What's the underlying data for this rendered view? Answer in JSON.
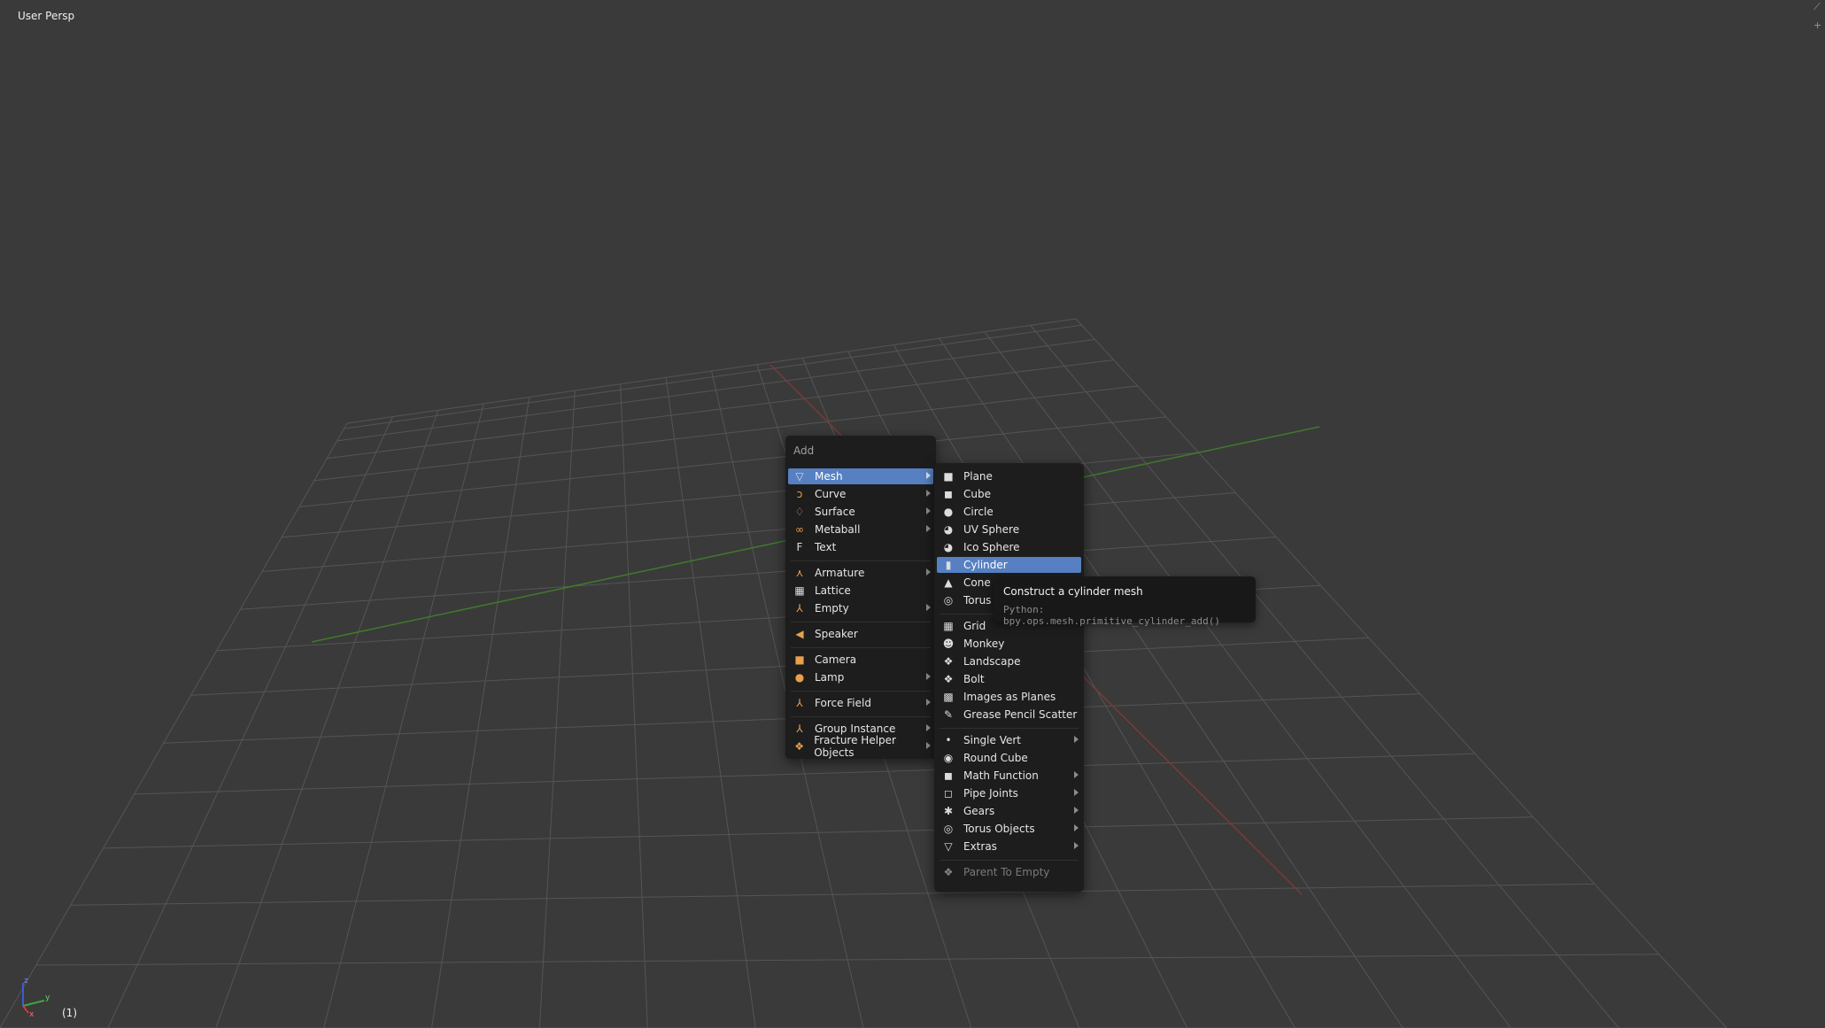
{
  "viewport": {
    "label": "User Persp",
    "frame": "(1)",
    "axes": [
      "z",
      "y",
      "x"
    ],
    "colors": {
      "background": "#3a3a3a",
      "grid": "#555555",
      "x_axis": "#7a3a3a",
      "y_axis": "#3f7a2c"
    }
  },
  "main_menu": {
    "title": "Add",
    "items": [
      {
        "label": "Mesh",
        "icon": "mesh-icon",
        "glyph": "▽",
        "submenu": true,
        "active": true
      },
      {
        "label": "Curve",
        "icon": "curve-icon",
        "glyph": "ↄ",
        "submenu": true
      },
      {
        "label": "Surface",
        "icon": "surface-icon",
        "glyph": "♢",
        "submenu": true
      },
      {
        "label": "Metaball",
        "icon": "metaball-icon",
        "glyph": "∞",
        "submenu": true
      },
      {
        "label": "Text",
        "icon": "text-icon",
        "glyph": "F",
        "submenu": false
      },
      {
        "label": "Armature",
        "icon": "armature-icon",
        "glyph": "⋏",
        "submenu": true
      },
      {
        "label": "Lattice",
        "icon": "lattice-icon",
        "glyph": "▦",
        "submenu": false
      },
      {
        "label": "Empty",
        "icon": "empty-icon",
        "glyph": "⅄",
        "submenu": true
      },
      {
        "label": "Speaker",
        "icon": "speaker-icon",
        "glyph": "◀",
        "submenu": false
      },
      {
        "label": "Camera",
        "icon": "camera-icon",
        "glyph": "■",
        "submenu": false
      },
      {
        "label": "Lamp",
        "icon": "lamp-icon",
        "glyph": "●",
        "submenu": true
      },
      {
        "label": "Force Field",
        "icon": "force-field-icon",
        "glyph": "⅄",
        "submenu": true
      },
      {
        "label": "Group Instance",
        "icon": "group-instance-icon",
        "glyph": "⅄",
        "submenu": true
      },
      {
        "label": "Fracture Helper Objects",
        "icon": "fracture-helper-icon",
        "glyph": "❖",
        "submenu": true
      }
    ]
  },
  "mesh_menu": {
    "items": [
      {
        "label": "Plane",
        "icon": "plane-icon",
        "glyph": "■"
      },
      {
        "label": "Cube",
        "icon": "cube-icon",
        "glyph": "◼"
      },
      {
        "label": "Circle",
        "icon": "circle-icon",
        "glyph": "●"
      },
      {
        "label": "UV Sphere",
        "icon": "uv-sphere-icon",
        "glyph": "◕"
      },
      {
        "label": "Ico Sphere",
        "icon": "ico-sphere-icon",
        "glyph": "◕"
      },
      {
        "label": "Cylinder",
        "icon": "cylinder-icon",
        "glyph": "▮",
        "active": true
      },
      {
        "label": "Cone",
        "icon": "cone-icon",
        "glyph": "▲"
      },
      {
        "label": "Torus",
        "icon": "torus-icon",
        "glyph": "◎"
      },
      {
        "label": "Grid",
        "icon": "grid-icon",
        "glyph": "▦"
      },
      {
        "label": "Monkey",
        "icon": "monkey-icon",
        "glyph": "☻"
      },
      {
        "label": "Landscape",
        "icon": "landscape-icon",
        "glyph": "❖"
      },
      {
        "label": "Bolt",
        "icon": "bolt-icon",
        "glyph": "❖"
      },
      {
        "label": "Images as Planes",
        "icon": "images-as-planes-icon",
        "glyph": "▩"
      },
      {
        "label": "Grease Pencil Scatter",
        "icon": "grease-pencil-icon",
        "glyph": "✎"
      },
      {
        "label": "Single Vert",
        "icon": "single-vert-icon",
        "glyph": "•",
        "submenu": true
      },
      {
        "label": "Round Cube",
        "icon": "round-cube-icon",
        "glyph": "◉"
      },
      {
        "label": "Math Function",
        "icon": "math-function-icon",
        "glyph": "◼",
        "submenu": true
      },
      {
        "label": "Pipe Joints",
        "icon": "pipe-joints-icon",
        "glyph": "◻",
        "submenu": true
      },
      {
        "label": "Gears",
        "icon": "gears-icon",
        "glyph": "✱",
        "submenu": true
      },
      {
        "label": "Torus Objects",
        "icon": "torus-objects-icon",
        "glyph": "◎",
        "submenu": true
      },
      {
        "label": "Extras",
        "icon": "extras-icon",
        "glyph": "▽",
        "submenu": true
      },
      {
        "label": "Parent To Empty",
        "icon": "parent-to-empty-icon",
        "glyph": "❖",
        "disabled": true
      }
    ]
  },
  "tooltip": {
    "title": "Construct a cylinder mesh",
    "python": "Python: bpy.ops.mesh.primitive_cylinder_add()"
  }
}
